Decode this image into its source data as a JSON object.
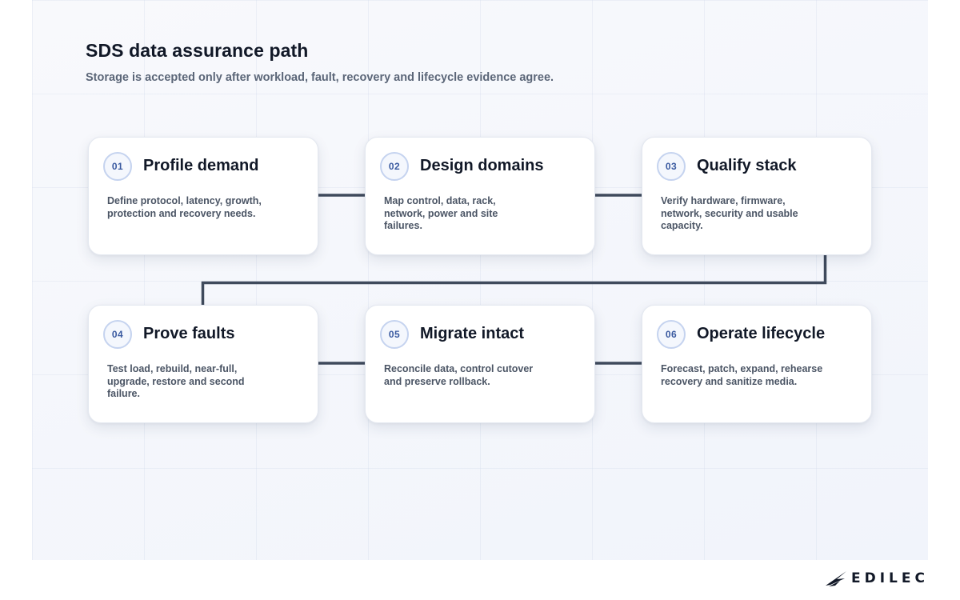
{
  "header": {
    "title": "SDS data assurance path",
    "subtitle": "Storage is accepted only after workload, fault, recovery and lifecycle evidence agree."
  },
  "steps": [
    {
      "number": "01",
      "title": "Profile demand",
      "desc": "Define protocol, latency, growth, protection and recovery needs."
    },
    {
      "number": "02",
      "title": "Design domains",
      "desc": "Map control, data, rack, network, power and site failures."
    },
    {
      "number": "03",
      "title": "Qualify stack",
      "desc": "Verify hardware, firmware, network, security and usable capacity."
    },
    {
      "number": "04",
      "title": "Prove faults",
      "desc": "Test load, rebuild, near-full, upgrade, restore and second failure."
    },
    {
      "number": "05",
      "title": "Migrate intact",
      "desc": "Reconcile data, control cutover and preserve rollback."
    },
    {
      "number": "06",
      "title": "Operate lifecycle",
      "desc": "Forecast, patch, expand, rehearse recovery and sanitize media."
    }
  ],
  "brand": {
    "name": "EDILEC",
    "icon": "bird-wing-icon"
  },
  "colors": {
    "connector": "#3f4a5c",
    "badge_border": "#c5d3ef",
    "badge_text": "#3a5aa0",
    "card_border": "#e4e8f0"
  }
}
